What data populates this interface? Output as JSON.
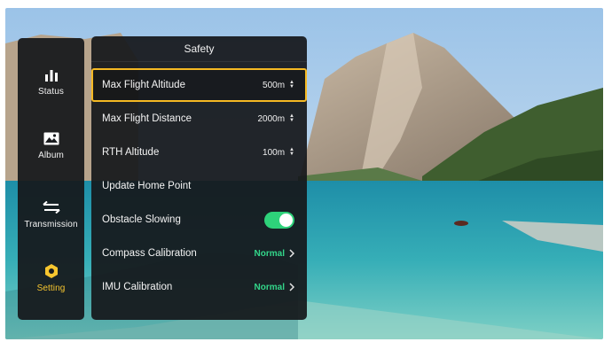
{
  "colors": {
    "accent": "#f5b923",
    "on": "#2ed27a",
    "normal": "#33d68a"
  },
  "nav": [
    {
      "label": "Status",
      "icon": "bar-chart-icon"
    },
    {
      "label": "Album",
      "icon": "image-icon"
    },
    {
      "label": "Transmission",
      "icon": "swap-arrows-icon"
    },
    {
      "label": "Setting",
      "icon": "hexagon-gear-icon",
      "active": true
    }
  ],
  "panel": {
    "title": "Safety",
    "rows": {
      "max_altitude": {
        "label": "Max Flight Altitude",
        "value": "500m"
      },
      "max_distance": {
        "label": "Max Flight Distance",
        "value": "2000m"
      },
      "rth_altitude": {
        "label": "RTH Altitude",
        "value": "100m"
      },
      "update_home": {
        "label": "Update Home Point"
      },
      "obstacle": {
        "label": "Obstacle Slowing",
        "enabled": true
      },
      "compass": {
        "label": "Compass Calibration",
        "status": "Normal"
      },
      "imu": {
        "label": "IMU Calibration",
        "status": "Normal"
      }
    }
  }
}
